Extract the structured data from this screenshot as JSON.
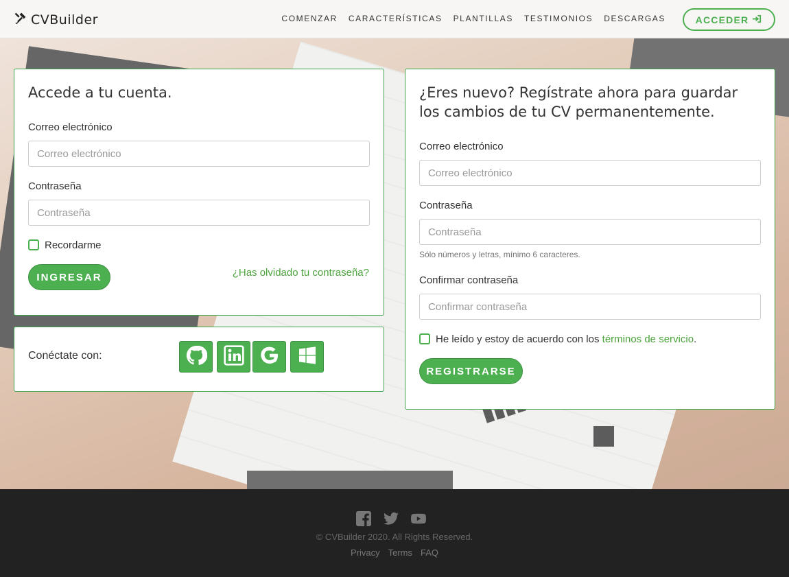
{
  "nav": {
    "brand": "CVBuilder",
    "links": [
      "COMENZAR",
      "CARACTERÍSTICAS",
      "PLANTILLAS",
      "TESTIMONIOS",
      "DESCARGAS"
    ],
    "login_label": "ACCEDER"
  },
  "login": {
    "title": "Accede a tu cuenta.",
    "email_label": "Correo electrónico",
    "email_placeholder": "Correo electrónico",
    "password_label": "Contraseña",
    "password_placeholder": "Contraseña",
    "remember_label": "Recordarme",
    "submit_label": "INGRESAR",
    "forgot_label": "¿Has olvidado tu contraseña?"
  },
  "social": {
    "label": "Conéctate con:",
    "providers": [
      "github",
      "linkedin",
      "google",
      "windows"
    ]
  },
  "register": {
    "title": "¿Eres nuevo? Regístrate ahora para guardar los cambios de tu CV permanentemente.",
    "email_label": "Correo electrónico",
    "email_placeholder": "Correo electrónico",
    "password_label": "Contraseña",
    "password_placeholder": "Contraseña",
    "password_hint": "Sólo números y letras, mínimo 6 caracteres.",
    "confirm_label": "Confirmar contraseña",
    "confirm_placeholder": "Confirmar contraseña",
    "terms_prefix": "He leído y estoy de acuerdo con los",
    "terms_link": "términos de servicio",
    "terms_suffix": ".",
    "submit_label": "REGISTRARSE"
  },
  "footer": {
    "icons": [
      "facebook-icon",
      "twitter-icon",
      "youtube-icon"
    ],
    "copyright": "© CVBuilder 2020. All Rights Reserved.",
    "links": [
      "Privacy",
      "Terms",
      "FAQ"
    ]
  },
  "colors": {
    "accent": "#4caf50",
    "footer_bg": "#222222"
  }
}
